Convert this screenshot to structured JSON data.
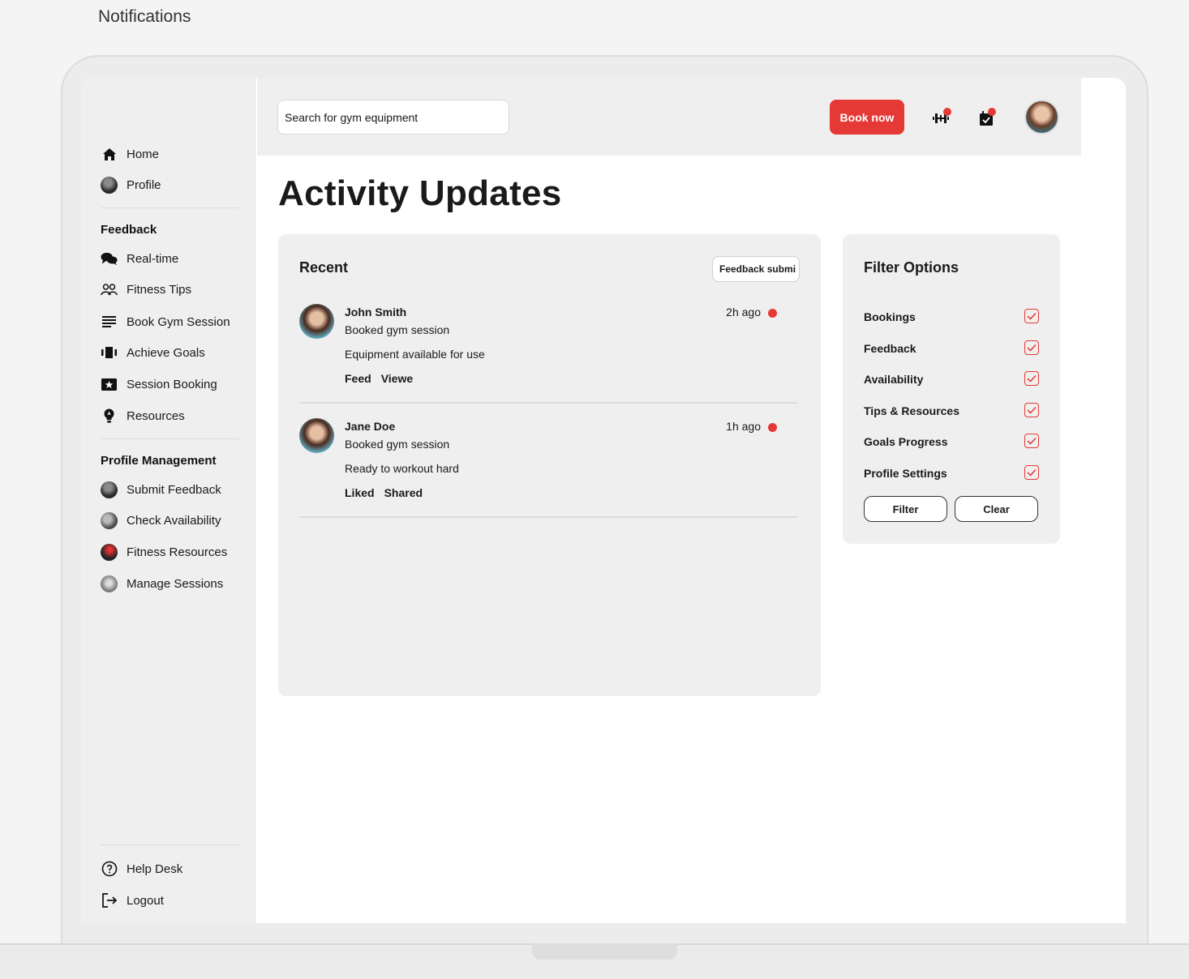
{
  "page_label": "Notifications",
  "sidebar": {
    "primary": [
      {
        "label": "Home",
        "icon": "home-icon"
      },
      {
        "label": "Profile",
        "icon": "profile-avatar"
      }
    ],
    "feedback_heading": "Feedback",
    "feedback_items": [
      {
        "label": "Real-time",
        "icon": "chat-icon"
      },
      {
        "label": "Fitness Tips",
        "icon": "people-icon"
      },
      {
        "label": "Book Gym Session",
        "icon": "list-icon"
      },
      {
        "label": "Achieve Goals",
        "icon": "carousel-icon"
      },
      {
        "label": "Session Booking",
        "icon": "ticket-star-icon"
      },
      {
        "label": "Resources",
        "icon": "bulb-icon"
      }
    ],
    "profile_heading": "Profile Management",
    "profile_items": [
      {
        "label": "Submit Feedback"
      },
      {
        "label": "Check Availability"
      },
      {
        "label": "Fitness Resources"
      },
      {
        "label": "Manage Sessions"
      }
    ],
    "footer_items": [
      {
        "label": "Help Desk",
        "icon": "help-icon"
      },
      {
        "label": "Logout",
        "icon": "logout-icon"
      }
    ]
  },
  "topbar": {
    "search_value": "Search for gym equipment",
    "book_label": "Book now",
    "accent": "#e53935"
  },
  "main": {
    "title": "Activity Updates",
    "recent": {
      "title": "Recent",
      "feedback_button": "Feedback submi",
      "activities": [
        {
          "name": "John Smith",
          "time": "2h ago",
          "line1": "Booked gym session",
          "line2": "Equipment available for use",
          "tags": [
            "Feed",
            "Viewe"
          ]
        },
        {
          "name": "Jane Doe",
          "time": "1h ago",
          "line1": "Booked gym session",
          "line2": "Ready to workout hard",
          "tags": [
            "Liked",
            "Shared"
          ]
        }
      ]
    },
    "filters": {
      "title": "Filter Options",
      "options": [
        {
          "label": "Bookings",
          "checked": true
        },
        {
          "label": "Feedback",
          "checked": true
        },
        {
          "label": "Availability",
          "checked": true
        },
        {
          "label": "Tips & Resources",
          "checked": true
        },
        {
          "label": "Goals Progress",
          "checked": true
        },
        {
          "label": "Profile Settings",
          "checked": true
        }
      ],
      "filter_button": "Filter",
      "clear_button": "Clear"
    }
  }
}
